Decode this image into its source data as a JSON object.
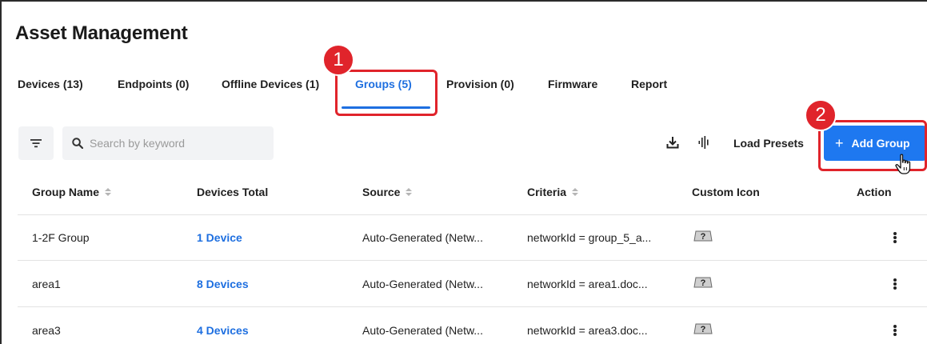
{
  "page": {
    "title": "Asset Management"
  },
  "tabs": [
    {
      "label": "Devices (13)",
      "active": false
    },
    {
      "label": "Endpoints (0)",
      "active": false
    },
    {
      "label": "Offline Devices (1)",
      "active": false
    },
    {
      "label": "Groups (5)",
      "active": true
    },
    {
      "label": "Provision (0)",
      "active": false
    },
    {
      "label": "Firmware",
      "active": false
    },
    {
      "label": "Report",
      "active": false
    }
  ],
  "callouts": {
    "first": "1",
    "second": "2"
  },
  "toolbar": {
    "search_placeholder": "Search by keyword",
    "load_presets_label": "Load Presets",
    "add_group_label": "Add Group",
    "add_group_plus": "+"
  },
  "table": {
    "columns": [
      "Group Name",
      "Devices Total",
      "Source",
      "Criteria",
      "Custom Icon",
      "Action"
    ],
    "rows": [
      {
        "name": "1-2F Group",
        "devices": "1 Device",
        "source": "Auto-Generated (Netw...",
        "criteria": "networkId = group_5_a..."
      },
      {
        "name": "area1",
        "devices": "8 Devices",
        "source": "Auto-Generated (Netw...",
        "criteria": "networkId = area1.doc..."
      },
      {
        "name": "area3",
        "devices": "4 Devices",
        "source": "Auto-Generated (Netw...",
        "criteria": "networkId = area3.doc..."
      }
    ]
  },
  "colors": {
    "accent": "#1e6fe0",
    "button": "#1e78f0",
    "callout": "#e0242b"
  },
  "icons": [
    "filter-icon",
    "search-icon",
    "download-icon",
    "waveform-icon",
    "plus-icon",
    "question-device-icon",
    "kebab-menu-icon",
    "hand-cursor-icon"
  ]
}
